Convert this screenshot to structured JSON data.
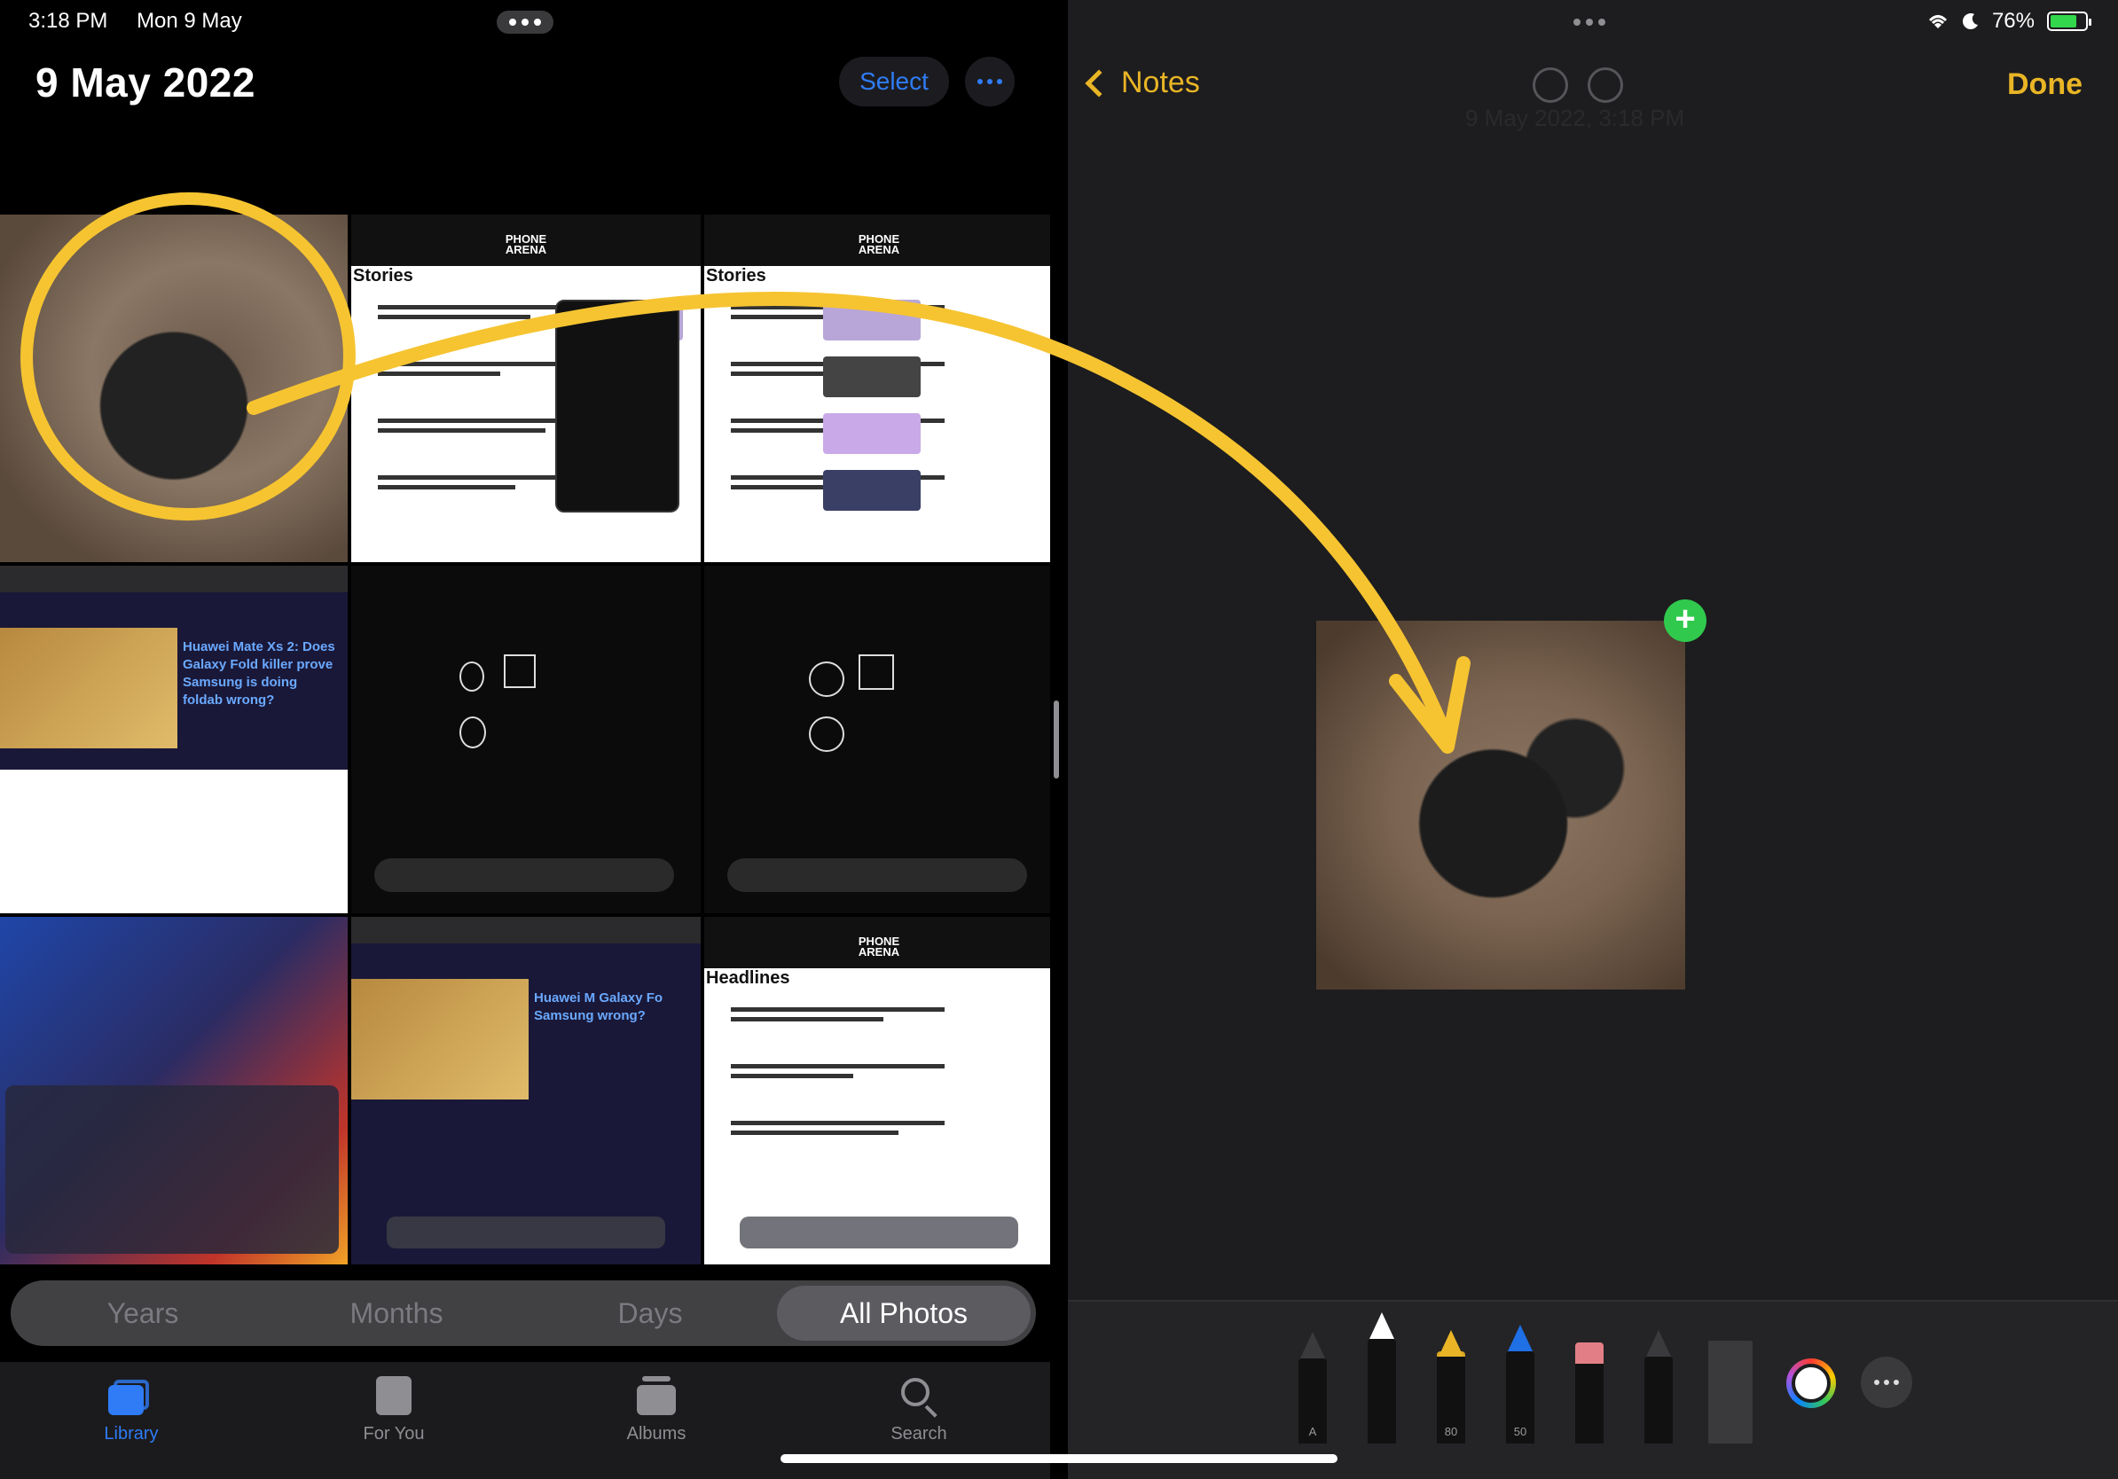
{
  "status": {
    "time": "3:18 PM",
    "date": "Mon 9 May",
    "battery": "76%",
    "battery_level": 0.76
  },
  "photos": {
    "title": "9 May 2022",
    "select_label": "Select",
    "grid_tiles": [
      {
        "kind": "photo-headphones"
      },
      {
        "kind": "webpage",
        "heading": "Stories"
      },
      {
        "kind": "webpage",
        "heading": "Stories"
      },
      {
        "kind": "news",
        "text": "Huawei Mate Xs 2: Does Galaxy Fold killer prove Samsung is doing foldab wrong?"
      },
      {
        "kind": "drawing"
      },
      {
        "kind": "drawing"
      },
      {
        "kind": "homescreen"
      },
      {
        "kind": "news",
        "text": "Huawei M Galaxy Fo Samsung wrong?"
      },
      {
        "kind": "webpage",
        "heading": "Headlines"
      }
    ],
    "segments": [
      {
        "label": "Years",
        "selected": false
      },
      {
        "label": "Months",
        "selected": false
      },
      {
        "label": "Days",
        "selected": false
      },
      {
        "label": "All Photos",
        "selected": true
      }
    ],
    "tabs": [
      {
        "label": "Library",
        "icon": "photo-library-icon",
        "selected": true
      },
      {
        "label": "For You",
        "icon": "for-you-icon",
        "selected": false
      },
      {
        "label": "Albums",
        "icon": "albums-icon",
        "selected": false
      },
      {
        "label": "Search",
        "icon": "search-icon",
        "selected": false
      }
    ]
  },
  "notes": {
    "back_label": "Notes",
    "done_label": "Done",
    "note_date": "9 May 2022, 3:18 PM",
    "tools": [
      {
        "name": "pen-monoline",
        "label": "A"
      },
      {
        "name": "pen",
        "label": ""
      },
      {
        "name": "marker",
        "label": "80"
      },
      {
        "name": "pencil",
        "label": "50"
      },
      {
        "name": "eraser",
        "label": ""
      },
      {
        "name": "crayon",
        "label": ""
      },
      {
        "name": "ruler",
        "label": ""
      }
    ]
  },
  "colors": {
    "accent_blue": "#2f7cf6",
    "notes_yellow": "#e9b526",
    "annotation_yellow": "#f6c431",
    "add_green": "#30c94d"
  }
}
